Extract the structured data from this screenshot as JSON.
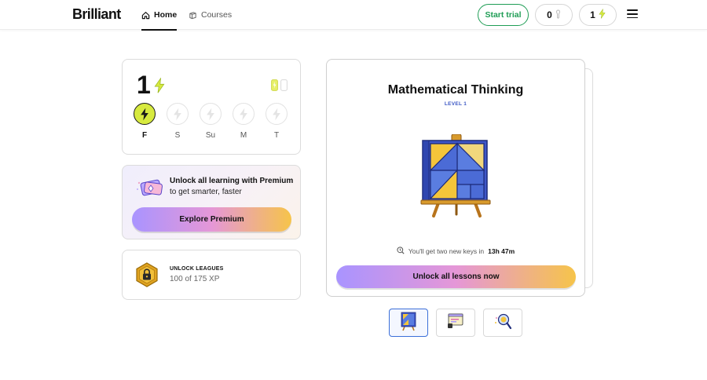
{
  "header": {
    "logo": "Brilliant",
    "nav": [
      {
        "label": "Home",
        "icon": "home-icon",
        "active": true
      },
      {
        "label": "Courses",
        "icon": "courses-icon",
        "active": false
      }
    ],
    "start_trial": "Start trial",
    "keys_count": "0",
    "streak_count": "1"
  },
  "streak": {
    "count": "1",
    "days": [
      {
        "label": "F",
        "active": true
      },
      {
        "label": "S",
        "active": false
      },
      {
        "label": "Su",
        "active": false
      },
      {
        "label": "M",
        "active": false
      },
      {
        "label": "T",
        "active": false
      }
    ]
  },
  "premium": {
    "title": "Unlock all learning with Premium",
    "subtitle": "to get smarter, faster",
    "button": "Explore Premium"
  },
  "leagues": {
    "title": "UNLOCK LEAGUES",
    "progress": "100 of 175 XP"
  },
  "course": {
    "title": "Mathematical Thinking",
    "level": "LEVEL 1",
    "keys_prefix": "You'll get two new keys in",
    "keys_time": "13h 47m",
    "button": "Unlock all lessons now"
  },
  "thumbnails": [
    {
      "icon": "easel-tangram-icon",
      "selected": true
    },
    {
      "icon": "code-window-icon",
      "selected": false
    },
    {
      "icon": "magnifier-icon",
      "selected": false
    }
  ],
  "colors": {
    "brand_green": "#1f9d55",
    "lightning": "#d7ea3f",
    "course_blue": "#3b57c4",
    "gradient": [
      "#a994ff",
      "#e597d7",
      "#f6c44a"
    ]
  }
}
